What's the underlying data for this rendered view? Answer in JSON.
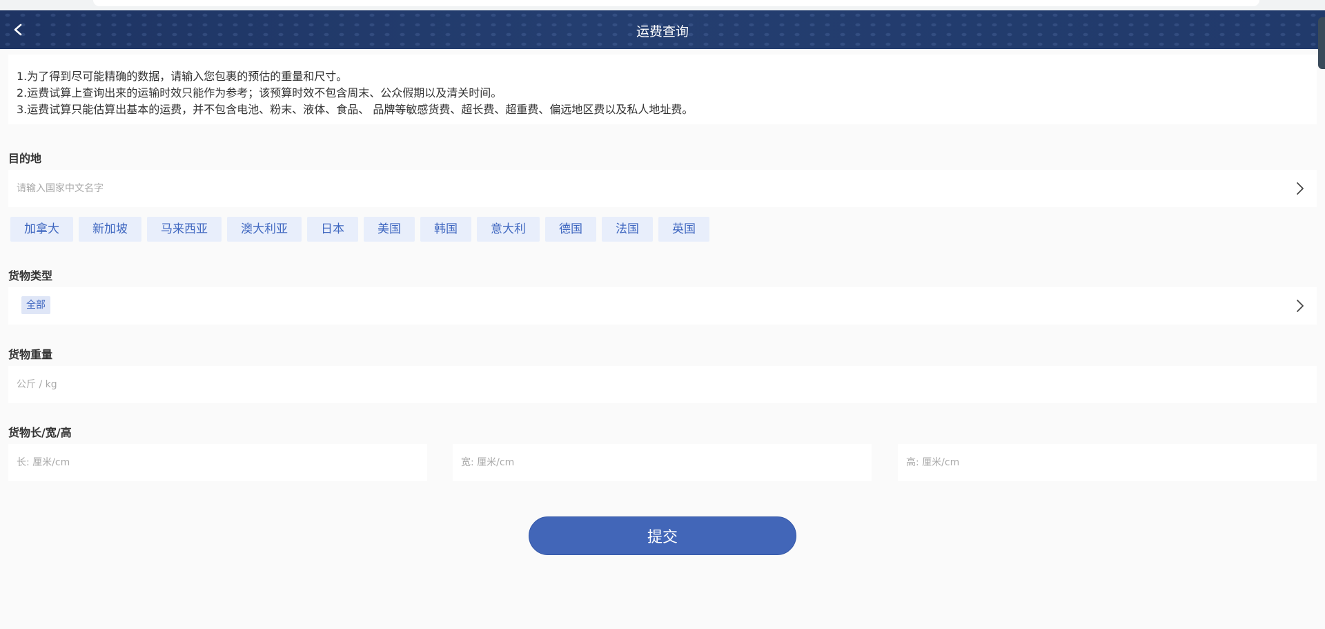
{
  "header": {
    "title": "运费查询"
  },
  "notice": {
    "lines": [
      "1.为了得到尽可能精确的数据，请输入您包裹的预估的重量和尺寸。",
      "2.运费试算上查询出来的运输时效只能作为参考；该预算时效不包含周末、公众假期以及清关时间。",
      "3.运费试算只能估算出基本的运费，并不包含电池、粉末、液体、食品、 品牌等敏感货费、超长费、超重费、偏远地区费以及私人地址费。"
    ]
  },
  "destination": {
    "label": "目的地",
    "placeholder": "请输入国家中文名字",
    "quick_countries": [
      "加拿大",
      "新加坡",
      "马来西亚",
      "澳大利亚",
      "日本",
      "美国",
      "韩国",
      "意大利",
      "德国",
      "法国",
      "英国"
    ]
  },
  "cargo_type": {
    "label": "货物类型",
    "selected": "全部"
  },
  "weight": {
    "label": "货物重量",
    "placeholder": "公斤 / kg"
  },
  "dimensions": {
    "label": "货物长/宽/高",
    "length_placeholder": "长: 厘米/cm",
    "width_placeholder": "宽: 厘米/cm",
    "height_placeholder": "高: 厘米/cm"
  },
  "submit": {
    "label": "提交"
  },
  "icons": {
    "back": "chevron-left-icon",
    "select": "chevron-right-icon"
  },
  "colors": {
    "header_bg": "#223b6c",
    "accent": "#4266b8",
    "tag_bg": "#e8eefb",
    "tag_text": "#3f67c0"
  }
}
